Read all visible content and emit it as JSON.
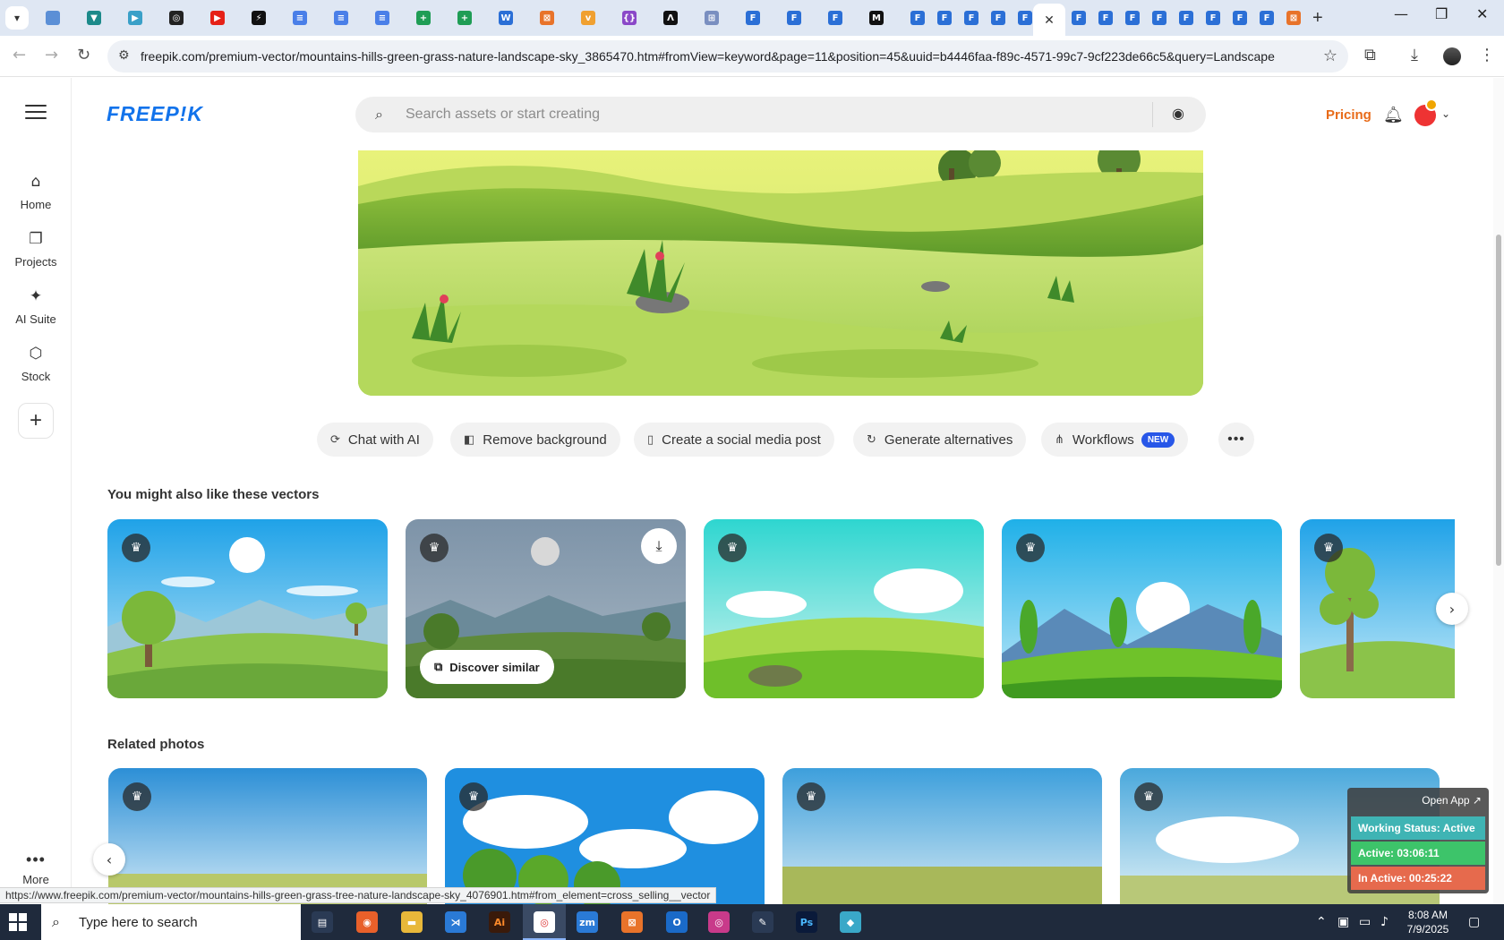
{
  "browser": {
    "url": "freepik.com/premium-vector/mountains-hills-green-grass-nature-landscape-sky_3865470.htm#fromView=keyword&page=11&position=45&uuid=b4446faa-f89c-4571-99c7-9cf223de66c5&query=Landscape",
    "active_tab_close": "✕",
    "new_tab": "+",
    "tabs": [
      {
        "icon": "globe-icon",
        "color": "#5b8fd6",
        "glyph": ""
      },
      {
        "icon": "vpn-icon",
        "color": "#1c8a8a",
        "glyph": "▼"
      },
      {
        "icon": "arrow-tab-icon",
        "color": "#3aa0c8",
        "glyph": "▶"
      },
      {
        "icon": "openai-icon",
        "color": "#222222",
        "glyph": "◎"
      },
      {
        "icon": "youtube-icon",
        "color": "#e62117",
        "glyph": "▶"
      },
      {
        "icon": "bolt-icon",
        "color": "#111111",
        "glyph": "⚡"
      },
      {
        "icon": "docs-icon",
        "color": "#4a7fe8",
        "glyph": "≡"
      },
      {
        "icon": "docs-icon",
        "color": "#4a7fe8",
        "glyph": "≡"
      },
      {
        "icon": "docs-icon",
        "color": "#4a7fe8",
        "glyph": "≡"
      },
      {
        "icon": "sheets-icon",
        "color": "#1f9d55",
        "glyph": "+"
      },
      {
        "icon": "sheets-icon",
        "color": "#1f9d55",
        "glyph": "+"
      },
      {
        "icon": "word-icon",
        "color": "#2b6fd6",
        "glyph": "W"
      },
      {
        "icon": "box-icon",
        "color": "#e8732a",
        "glyph": "⊠"
      },
      {
        "icon": "vee-icon",
        "color": "#f0a030",
        "glyph": "v"
      },
      {
        "icon": "brackets-icon",
        "color": "#8a48c8",
        "glyph": "{}"
      },
      {
        "icon": "lambda-icon",
        "color": "#111111",
        "glyph": "Λ"
      },
      {
        "icon": "grid-icon",
        "color": "#7a8fc0",
        "glyph": "⊞"
      },
      {
        "icon": "forms-icon",
        "color": "#2b6fd6",
        "glyph": "F"
      },
      {
        "icon": "forms-icon",
        "color": "#2b6fd6",
        "glyph": "F"
      },
      {
        "icon": "forms-icon",
        "color": "#2b6fd6",
        "glyph": "F"
      },
      {
        "icon": "medium-icon",
        "color": "#111111",
        "glyph": "M"
      },
      {
        "icon": "forms-icon",
        "color": "#2b6fd6",
        "glyph": "F"
      },
      {
        "icon": "forms-icon",
        "color": "#2b6fd6",
        "glyph": "F"
      },
      {
        "icon": "forms-icon",
        "color": "#2b6fd6",
        "glyph": "F"
      },
      {
        "icon": "forms-icon",
        "color": "#2b6fd6",
        "glyph": "F"
      },
      {
        "icon": "forms-icon",
        "color": "#2b6fd6",
        "glyph": "F"
      },
      {
        "icon": "forms-icon",
        "color": "#2b6fd6",
        "glyph": "F"
      },
      {
        "icon": "forms-icon",
        "color": "#2b6fd6",
        "glyph": "F"
      },
      {
        "icon": "forms-icon",
        "color": "#2b6fd6",
        "glyph": "F"
      },
      {
        "icon": "forms-icon",
        "color": "#2b6fd6",
        "glyph": "F"
      },
      {
        "icon": "forms-icon",
        "color": "#2b6fd6",
        "glyph": "F"
      },
      {
        "icon": "forms-icon",
        "color": "#2b6fd6",
        "glyph": "F"
      },
      {
        "icon": "forms-icon",
        "color": "#2b6fd6",
        "glyph": "F"
      },
      {
        "icon": "forms-icon",
        "color": "#2b6fd6",
        "glyph": "F"
      },
      {
        "icon": "box-icon",
        "color": "#e8732a",
        "glyph": "⊠"
      }
    ]
  },
  "sidebar": {
    "items": [
      {
        "label": "Home",
        "icon": "home-icon",
        "glyph": "⌂"
      },
      {
        "label": "Projects",
        "icon": "projects-icon",
        "glyph": "❐"
      },
      {
        "label": "AI Suite",
        "icon": "sparkle-icon",
        "glyph": "✦"
      },
      {
        "label": "Stock",
        "icon": "stock-icon",
        "glyph": "⬡"
      }
    ],
    "add_glyph": "+",
    "more_label": "More",
    "more_glyph": "•••"
  },
  "header": {
    "logo": "FREEP!K",
    "search_placeholder": "Search assets or start creating",
    "pricing": "Pricing",
    "brand_color": "#1273eb",
    "pricing_color": "#e86b19"
  },
  "actions": [
    {
      "label": "Chat with AI",
      "icon": "chat-ai-icon",
      "glyph": "⟳"
    },
    {
      "label": "Remove background",
      "icon": "remove-bg-icon",
      "glyph": "◧"
    },
    {
      "label": "Create a social media post",
      "icon": "phone-icon",
      "glyph": "▯"
    },
    {
      "label": "Generate alternatives",
      "icon": "refresh-icon",
      "glyph": "↻"
    },
    {
      "label": "Workflows",
      "icon": "workflow-icon",
      "glyph": "⋔",
      "badge": "NEW"
    }
  ],
  "more_actions": "•••",
  "vectors_section": {
    "title": "You might also like these vectors",
    "discover_label": "Discover similar"
  },
  "photos_section": {
    "title": "Related photos"
  },
  "status_url": "https://www.freepik.com/premium-vector/mountains-hills-green-grass-tree-nature-landscape-sky_4076901.htm#from_element=cross_selling__vector",
  "widget": {
    "open_app": "Open App ↗",
    "working_status": "Working Status: Active",
    "active": "Active: 03:06:11",
    "inactive": "In Active: 00:25:22"
  },
  "taskbar": {
    "search_placeholder": "Type here to search",
    "time": "8:08 AM",
    "date": "7/9/2025"
  }
}
